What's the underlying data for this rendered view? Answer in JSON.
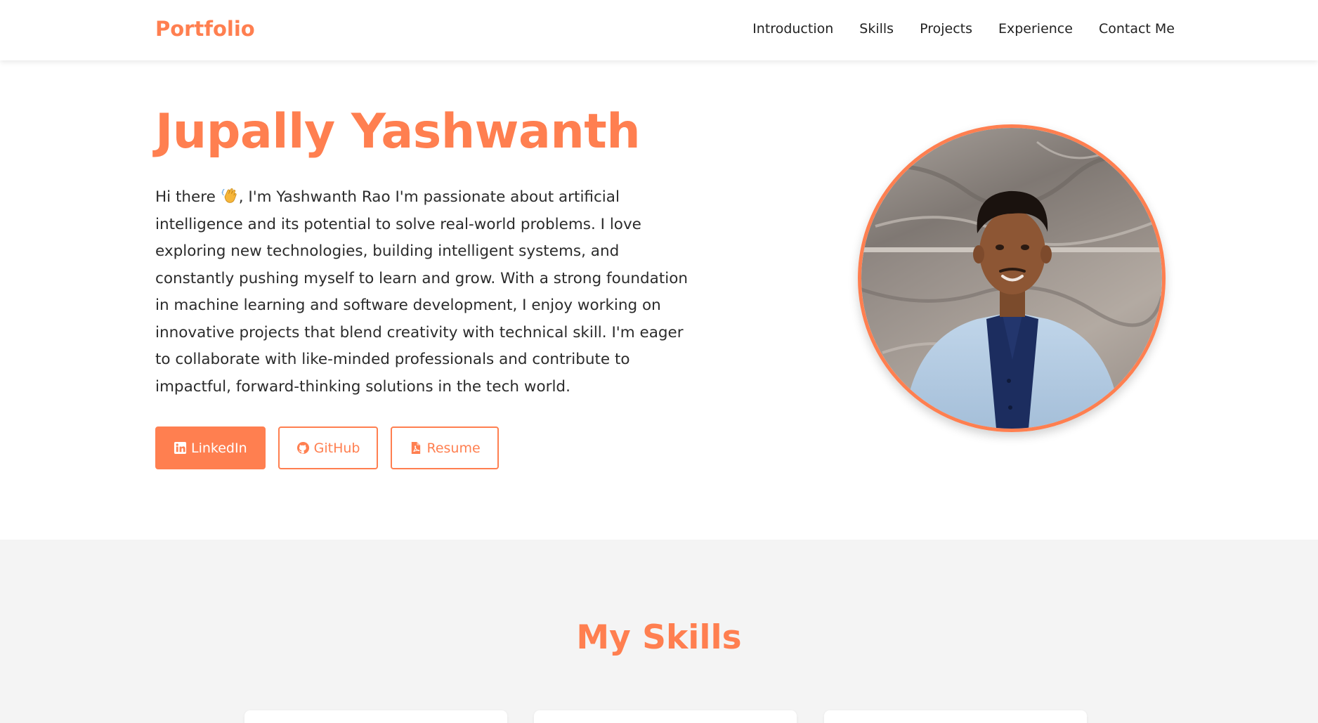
{
  "nav": {
    "brand": "Portfolio",
    "links": [
      "Introduction",
      "Skills",
      "Projects",
      "Experience",
      "Contact Me"
    ]
  },
  "hero": {
    "name": "Jupally Yashwanth",
    "intro_before_icon": "Hi there ",
    "intro_icon": "waving-hand-emoji",
    "intro_after_icon": ", I'm Yashwanth Rao I'm passionate about artificial intelligence and its potential to solve real-world problems. I love exploring new technologies, building intelligent systems, and constantly pushing myself to learn and grow. With a strong foundation in machine learning and software development, I enjoy working on innovative projects that blend creativity with technical skill. I'm eager to collaborate with like-minded professionals and contribute to impactful, forward-thinking solutions in the tech world.",
    "buttons": [
      {
        "label": "LinkedIn",
        "icon": "linkedin-icon"
      },
      {
        "label": "GitHub",
        "icon": "github-icon"
      },
      {
        "label": "Resume",
        "icon": "pdf-file-icon"
      }
    ]
  },
  "skills": {
    "title": "My Skills"
  },
  "colors": {
    "accent": "#ff7f50",
    "text": "#222222",
    "section_bg": "#f4f4f4"
  }
}
